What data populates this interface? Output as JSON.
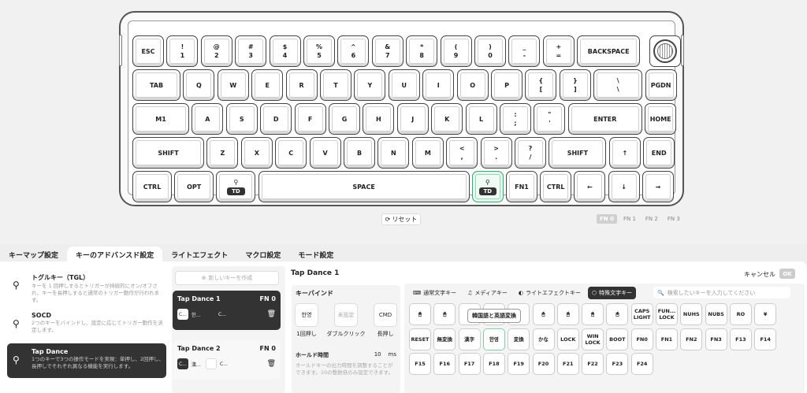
{
  "keyboard": {
    "row1": [
      "ESC",
      "!|1",
      "@|2",
      "#|3",
      "$|4",
      "%|5",
      "^|6",
      "&|7",
      "*|8",
      "(|9",
      ")|0",
      "_|-",
      "+|=",
      "BACKSPACE"
    ],
    "row2": [
      "TAB",
      "Q",
      "W",
      "E",
      "R",
      "T",
      "Y",
      "U",
      "I",
      "O",
      "P",
      "{|[",
      "}|]",
      "\\||\\",
      "PGDN"
    ],
    "row3": [
      "M1",
      "A",
      "S",
      "D",
      "F",
      "G",
      "H",
      "J",
      "K",
      "L",
      ":|;",
      "\"|'",
      "ENTER",
      "HOME"
    ],
    "row4": [
      "SHIFT",
      "Z",
      "X",
      "C",
      "V",
      "B",
      "N",
      "M",
      "<|,",
      ">|.",
      "?|/",
      "SHIFT",
      "↑",
      "END"
    ],
    "row5": {
      "ctrl": "CTRL",
      "opt": "OPT",
      "td1": "TD",
      "space": "SPACE",
      "td2": "TD",
      "fn1": "FN1",
      "ctrl2": "CTRL",
      "left": "←",
      "down": "↓",
      "right": "→"
    },
    "knob_icon": "rotary-knob-icon"
  },
  "reset_label": "リセット",
  "layers": [
    "FN 0",
    "FN 1",
    "FN 2",
    "FN 3"
  ],
  "tabs": [
    "キーマップ設定",
    "キーのアドバンスド設定",
    "ライトエフェクト",
    "マクロ設定",
    "モード設定"
  ],
  "side": [
    {
      "title": "トグルキー（TGL）",
      "desc": "キーを 1 回押しするとトリガーが持続的にオン/オフされ、キーを長押しすると通常のトリガー動作が行われます。"
    },
    {
      "title": "SOCD",
      "desc": "2つのキーをバインドし、設定に応じてトリガー動作を決定します。"
    },
    {
      "title": "Tap Dance",
      "desc": "1つのキーで3つの操作モードを実現：単押し、2回押し、長押しでそれぞれ異なる機能を実行します。"
    }
  ],
  "new_key": "新しいキーを作成",
  "cards": [
    {
      "title": "Tap Dance  1",
      "fn": "FN 0",
      "k1": "C...",
      "t1": "한...",
      "k2": "C..."
    },
    {
      "title": "Tap Dance  2",
      "fn": "FN 0",
      "k1": "C...",
      "t1": "漢...",
      "k2": "C..."
    }
  ],
  "editor": {
    "title": "Tap Dance 1",
    "bind_label": "キーバインド",
    "b1": "한영",
    "b2": "未設定",
    "b3": "CMD",
    "l1": "1回押し",
    "l2": "ダブルクリック",
    "l3": "長押し",
    "hold_label": "ホールド時間",
    "hold_value": "10",
    "hold_unit": "ms",
    "note": "ホールドキーの出力時間を調整することができます。10の整数倍のみ設定できます。"
  },
  "cancel": "キャンセル",
  "ok": "OK",
  "ktabs": [
    "通常文字キー",
    "メディアキー",
    "ライトエフェクトキー",
    "特殊文字キー"
  ],
  "search_placeholder": "検索したいキーを入力してください",
  "tooltip": "韓国語と英語変換",
  "special_keys": [
    [
      "🖱",
      "🖱",
      "",
      "",
      "",
      "🖱",
      "🖱",
      "🖱",
      "🖱",
      "CAPS LIGHT",
      "FUN... LOCK",
      "NUHS",
      "NUBS",
      "RO",
      "¥"
    ],
    [
      "RESET",
      "無変換",
      "漢字",
      "한영",
      "変換",
      "かな",
      "LOCK",
      "WIN LOCK",
      "BOOT",
      "FN0",
      "FN1",
      "FN2",
      "FN3",
      "F13",
      "F14"
    ],
    [
      "F15",
      "F16",
      "F17",
      "F18",
      "F19",
      "F20",
      "F21",
      "F22",
      "F23",
      "F24"
    ]
  ]
}
